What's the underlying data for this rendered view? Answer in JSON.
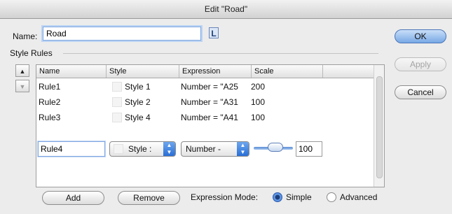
{
  "window": {
    "title": "Edit \"Road\""
  },
  "form": {
    "name_label": "Name:",
    "name_value": "Road",
    "label_icon": "L",
    "style_rules_label": "Style Rules"
  },
  "table": {
    "columns": [
      "Name",
      "Style",
      "Expression",
      "Scale"
    ],
    "rows": [
      {
        "name": "Rule1",
        "style": "Style 1",
        "expression": "Number = \"A25",
        "scale": "200"
      },
      {
        "name": "Rule2",
        "style": "Style 2",
        "expression": "Number = \"A31",
        "scale": "100"
      },
      {
        "name": "Rule3",
        "style": "Style 4",
        "expression": "Number = \"A41",
        "scale": "100"
      }
    ],
    "edit_row": {
      "name": "Rule4",
      "style": "Style :",
      "expression": "Number -",
      "scale": "100",
      "slider_level": 0.55
    }
  },
  "buttons": {
    "ok": "OK",
    "apply": "Apply",
    "cancel": "Cancel",
    "add": "Add",
    "remove": "Remove",
    "move_up": "▲",
    "move_down": "▼"
  },
  "expression_mode": {
    "label": "Expression Mode:",
    "options": [
      "Simple",
      "Advanced"
    ],
    "selected": "Simple"
  },
  "colors": {
    "accent": "#3a78d8",
    "focus_ring": "#7fa7e0"
  }
}
